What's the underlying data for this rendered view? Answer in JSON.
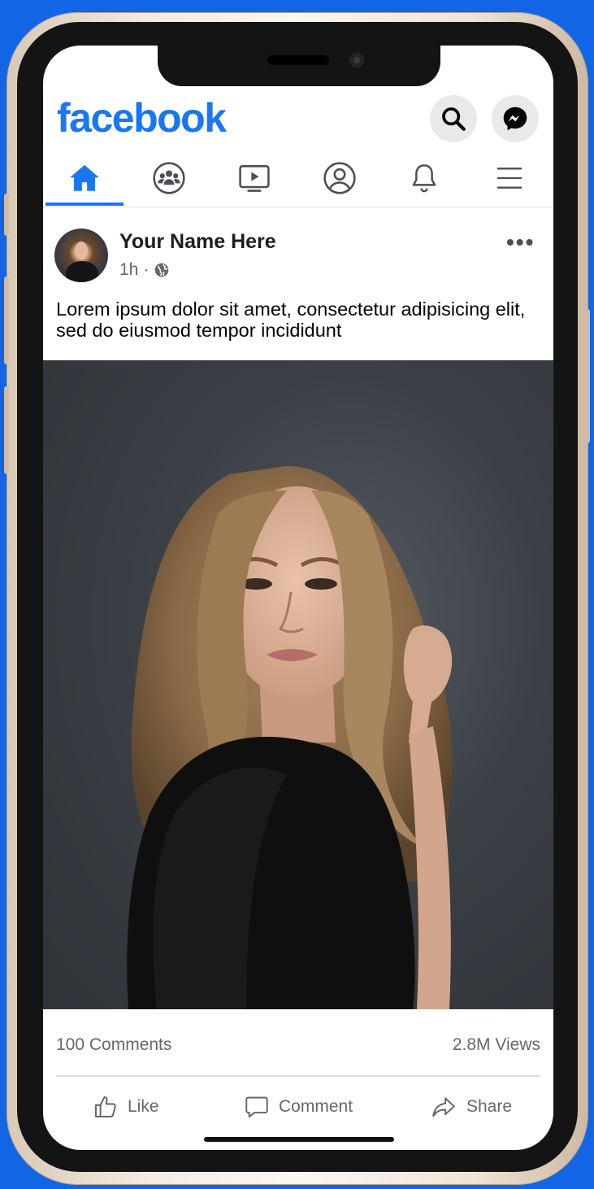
{
  "app": {
    "brand": "facebook",
    "brand_color": "#1877f2"
  },
  "header": {
    "search_icon": "search-icon",
    "messenger_icon": "messenger-icon"
  },
  "nav": {
    "tabs": [
      {
        "name": "home",
        "icon": "home-icon",
        "active": true
      },
      {
        "name": "groups",
        "icon": "groups-icon",
        "active": false
      },
      {
        "name": "watch",
        "icon": "video-icon",
        "active": false
      },
      {
        "name": "profile",
        "icon": "profile-icon",
        "active": false
      },
      {
        "name": "notifications",
        "icon": "bell-icon",
        "active": false
      },
      {
        "name": "menu",
        "icon": "menu-icon",
        "active": false
      }
    ]
  },
  "post": {
    "author": "Your Name Here",
    "time": "1h",
    "separator": "·",
    "privacy_icon": "globe-icon",
    "text": "Lorem ipsum dolor sit amet, consectetur adipisicing elit, sed do eiusmod tempor incididunt",
    "image_description_icon": "photo-portrait"
  },
  "stats": {
    "comments": "100 Comments",
    "views": "2.8M Views"
  },
  "actions": {
    "like": "Like",
    "comment": "Comment",
    "share": "Share"
  }
}
